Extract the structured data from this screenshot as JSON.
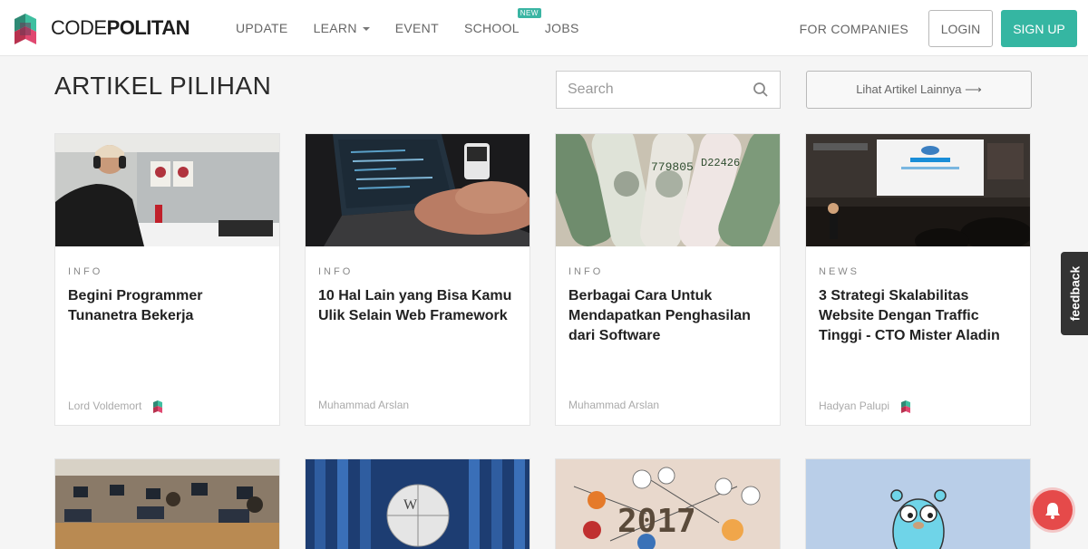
{
  "brand": {
    "name_light": "CODE",
    "name_bold": "POLITAN"
  },
  "nav": {
    "items": [
      {
        "label": "UPDATE",
        "dropdown": false,
        "badge": ""
      },
      {
        "label": "LEARN",
        "dropdown": true,
        "badge": ""
      },
      {
        "label": "EVENT",
        "dropdown": false,
        "badge": ""
      },
      {
        "label": "SCHOOL",
        "dropdown": false,
        "badge": "NEW"
      },
      {
        "label": "JOBS",
        "dropdown": false,
        "badge": ""
      }
    ],
    "for_companies": "FOR COMPANIES",
    "login": "LOGIN",
    "signup": "SIGN UP"
  },
  "header": {
    "title": "ARTIKEL PILIHAN",
    "search_placeholder": "Search",
    "see_more": "Lihat Artikel Lainnya ⟶"
  },
  "articles": [
    {
      "category": "INFO",
      "title": "Begini Programmer Tunanetra Bekerja",
      "author": "Lord Voldemort",
      "author_badge": true,
      "image": "programmer-with-headphones"
    },
    {
      "category": "INFO",
      "title": "10 Hal Lain yang Bisa Kamu Ulik Selain Web Framework",
      "author": "Muhammad Arslan",
      "author_badge": false,
      "image": "laptop-coding"
    },
    {
      "category": "INFO",
      "title": "Berbagai Cara Untuk Mendapatkan Penghasilan dari Software",
      "author": "Muhammad Arslan",
      "author_badge": false,
      "image": "dollar-bills"
    },
    {
      "category": "NEWS",
      "title": "3 Strategi Skalabilitas Website Dengan Traffic Tinggi - CTO Mister Aladin",
      "author": "Hadyan Palupi",
      "author_badge": true,
      "image": "conference-stage"
    }
  ],
  "articles_row2": [
    {
      "image": "classroom-computers"
    },
    {
      "image": "wikipedia-globe"
    },
    {
      "image": "2017-tech-icons"
    },
    {
      "image": "go-gopher"
    }
  ],
  "feedback_label": "feedback",
  "colors": {
    "accent": "#35b6a2",
    "badge": "#3ab5a3",
    "notification": "#e54a4a"
  }
}
